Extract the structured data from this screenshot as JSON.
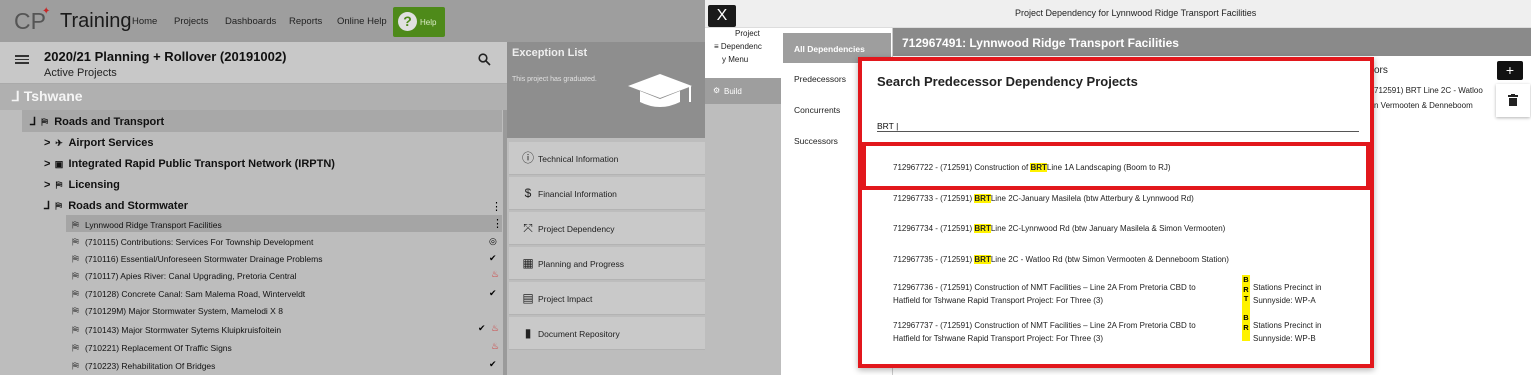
{
  "app": {
    "logo": "CP",
    "title": "Training",
    "nav": [
      "Home",
      "Projects",
      "Dashboards",
      "Reports",
      "Online Help"
    ],
    "help_label": "Help"
  },
  "project_panel": {
    "plan": "2020/21 Planning + Rollover (20191002)",
    "filter": "Active Projects",
    "region": "Tshwane",
    "roads_and_transport": "Roads and Transport",
    "groups": [
      {
        "label": "Airport Services",
        "icon": "airplane-icon"
      },
      {
        "label": "Integrated Rapid Public Transport Network (IRPTN)",
        "icon": "bus-icon"
      },
      {
        "label": "Licensing",
        "icon": "road-icon"
      },
      {
        "label": "Roads and Stormwater",
        "icon": "road-icon"
      }
    ],
    "projects": [
      {
        "label": "Lynnwood Ridge Transport Facilities",
        "status": "kebab"
      },
      {
        "label": "(710115) Contributions: Services For Township Development",
        "status": "target"
      },
      {
        "label": "(710116) Essential/Unforeseen Stormwater Drainage Problems",
        "status": "check"
      },
      {
        "label": "(710117) Apies River: Canal Upgrading, Pretoria Central",
        "status": "fire"
      },
      {
        "label": "(710128) Concrete Canal: Sam Malema Road, Winterveldt",
        "status": "check"
      },
      {
        "label": "(710129M) Major Stormwater System, Mamelodi X 8",
        "status": ""
      },
      {
        "label": "(710143) Major Stormwater Sytems Kluipkruisfoitein",
        "status": "check-fire"
      },
      {
        "label": "(710221) Replacement Of Traffic Signs",
        "status": "fire"
      },
      {
        "label": "(710223) Rehabilitation Of Bridges",
        "status": "check"
      }
    ]
  },
  "exception": {
    "title": "Exception List",
    "subtitle": "This project has graduated.",
    "menu": [
      {
        "label": "Technical Information",
        "icon": "info-icon"
      },
      {
        "label": "Financial Information",
        "icon": "dollar-icon"
      },
      {
        "label": "Project Dependency",
        "icon": "dependency-icon"
      },
      {
        "label": "Planning and Progress",
        "icon": "calendar-icon"
      },
      {
        "label": "Project Impact",
        "icon": "impact-icon"
      },
      {
        "label": "Document Repository",
        "icon": "document-icon"
      }
    ]
  },
  "dialog": {
    "close": "X",
    "title": "Project Dependency for Lynnwood Ridge Transport Facilities",
    "project_menu": [
      "Project",
      "≡ Dependenc",
      "y Menu"
    ],
    "build": "Build",
    "tabs": [
      "All Dependencies",
      "Predecessors",
      "Concurrents",
      "Successors"
    ],
    "header": "712967491: Lynnwood Ridge Transport Facilities",
    "peek_col": "ors",
    "peek_row1": "712591) BRT Line 2C - Watloo",
    "peek_row2": "n Vermooten & Denneboom",
    "add": "+"
  },
  "search": {
    "title": "Search Predecessor Dependency Projects",
    "value": "BRT",
    "term": "BRT",
    "results": [
      {
        "pre": "712967722 - (712591) Construction of ",
        "post": "Line 1A Landscaping (Boom to RJ)"
      },
      {
        "pre": "712967733 - (712591) ",
        "post": "Line 2C-January Masilela (btw Atterbury & Lynnwood Rd)"
      },
      {
        "pre": "712967734 - (712591) ",
        "post": "Line 2C-Lynnwood Rd (btw January Masilela & Simon Vermooten)"
      },
      {
        "pre": "712967735 - (712591) ",
        "post": "Line 2C - Watloo Rd (btw Simon Vermooten & Denneboom Station)"
      }
    ],
    "multi": [
      {
        "l1": "712967736 - (712591) Construction of NMT Facilities – Line 2A From Pretoria CBD to",
        "l2": "Hatfield for Tshwane Rapid Transport Project: For Three (3)",
        "v": "B R T",
        "r1": "Stations Precinct in",
        "r2": "Sunnyside: WP-A"
      },
      {
        "l1": "712967737 - (712591) Construction of NMT Facilities – Line 2A From Pretoria CBD to",
        "l2": "Hatfield for Tshwane Rapid Transport Project: For Three (3)",
        "v": "B R",
        "r1": "Stations Precinct in",
        "r2": "Sunnyside: WP-B"
      }
    ]
  },
  "colors": {
    "red": "#e2171c",
    "highlight": "#fff200",
    "help_green": "#4e8a1a"
  }
}
